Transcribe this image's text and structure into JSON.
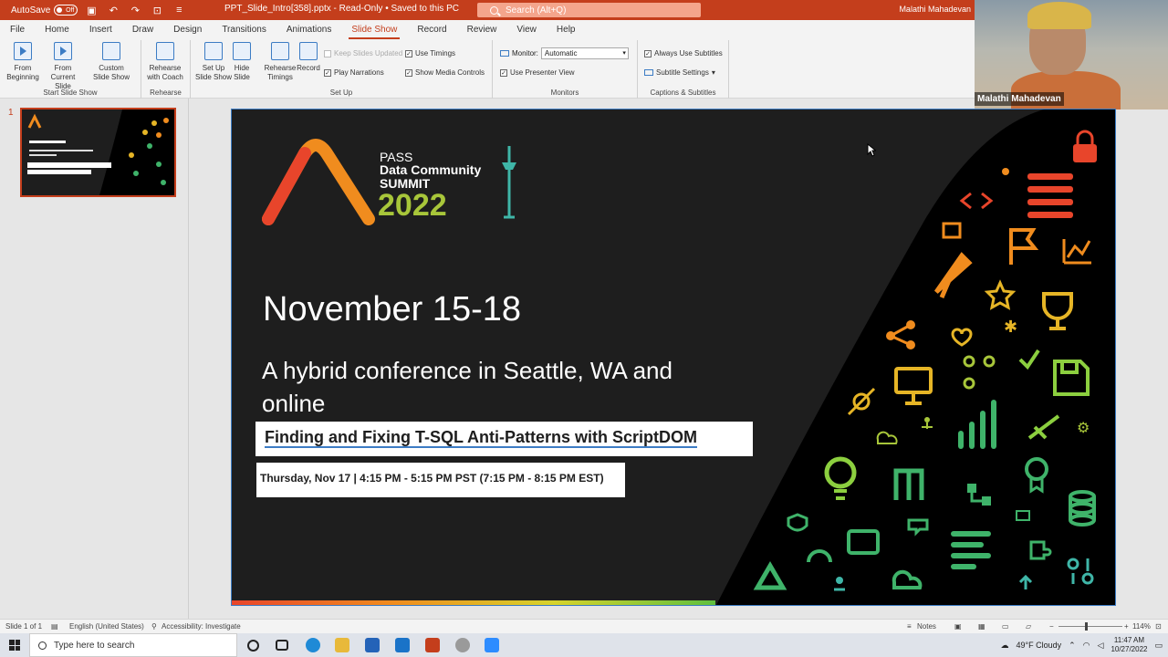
{
  "titlebar": {
    "autosave_label": "AutoSave",
    "autosave_state": "Off",
    "doc_title": "PPT_Slide_Intro[358].pptx  -  Read-Only  •  Saved to this PC",
    "search_placeholder": "Search (Alt+Q)",
    "user_name": "Malathi Mahadevan"
  },
  "tabs": [
    "File",
    "Home",
    "Insert",
    "Draw",
    "Design",
    "Transitions",
    "Animations",
    "Slide Show",
    "Record",
    "Review",
    "View",
    "Help"
  ],
  "active_tab": "Slide Show",
  "ribbon": {
    "start_group": {
      "label": "Start Slide Show",
      "from_beginning": "From Beginning",
      "from_current": "From Current Slide",
      "custom": "Custom Slide Show"
    },
    "rehearse_group": {
      "label": "Rehearse",
      "rehearse_coach": "Rehearse with Coach"
    },
    "setup_group": {
      "label": "Set Up",
      "setup_show": "Set Up Slide Show",
      "hide_slide": "Hide Slide",
      "rehearse_timings": "Rehearse Timings",
      "record": "Record",
      "keep_updated": "Keep Slides Updated",
      "play_narrations": "Play Narrations",
      "use_timings": "Use Timings",
      "show_media": "Show Media Controls"
    },
    "monitors_group": {
      "label": "Monitors",
      "monitor_label": "Monitor:",
      "monitor_value": "Automatic",
      "presenter_view": "Use Presenter View"
    },
    "captions_group": {
      "label": "Captions & Subtitles",
      "always_subtitles": "Always Use Subtitles",
      "subtitle_settings": "Subtitle Settings"
    }
  },
  "webcam": {
    "name": "Malathi Mahadevan"
  },
  "thumbnails": {
    "slide_number": "1"
  },
  "slide": {
    "logo_pass": "PASS",
    "logo_dc": "Data Community",
    "logo_summit": "SUMMIT",
    "logo_year": "2022",
    "date": "November 15-18",
    "subtitle": "A hybrid conference in Seattle, WA and online",
    "session_title": "Finding and Fixing T-SQL Anti-Patterns with ScriptDOM",
    "time": "Thursday, Nov 17  |  4:15 PM - 5:15 PM PST  (7:15 PM - 8:15 PM EST)"
  },
  "statusbar": {
    "slide_count": "Slide 1 of 1",
    "language": "English (United States)",
    "accessibility": "Accessibility: Investigate",
    "notes": "Notes",
    "zoom": "114%"
  },
  "taskbar": {
    "search_placeholder": "Type here to search",
    "weather": "49°F  Cloudy",
    "time": "11:47 AM",
    "date": "10/27/2022"
  },
  "colors": {
    "accent": "#c43e1c",
    "slide_bg": "#1e1e1e",
    "orange": "#f08c1e",
    "yellow": "#e6b526",
    "green": "#3fb36a"
  }
}
